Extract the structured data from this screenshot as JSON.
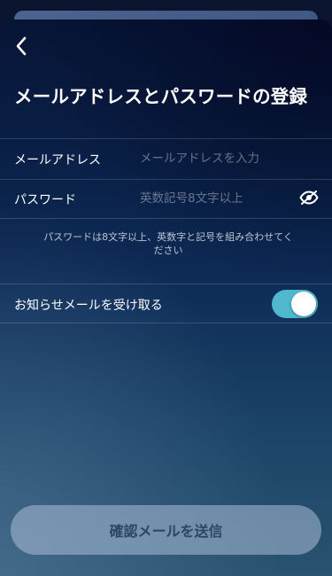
{
  "header": {
    "back_icon": "chevron-left-icon",
    "title": "メールアドレスとパスワードの登録"
  },
  "form": {
    "email": {
      "label": "メールアドレス",
      "value": "",
      "placeholder": "メールアドレスを入力"
    },
    "password": {
      "label": "パスワード",
      "value": "",
      "placeholder": "英数記号8文字以上",
      "visibility_icon": "eye-off-icon"
    },
    "hint": "パスワードは8文字以上、英数字と記号を組み合わせてください"
  },
  "newsletter": {
    "label": "お知らせメールを受け取る",
    "enabled": true
  },
  "submit": {
    "label": "確認メールを送信",
    "enabled": false
  },
  "colors": {
    "toggle_on": "#4fb8cf",
    "button_text": "#2d4566"
  }
}
